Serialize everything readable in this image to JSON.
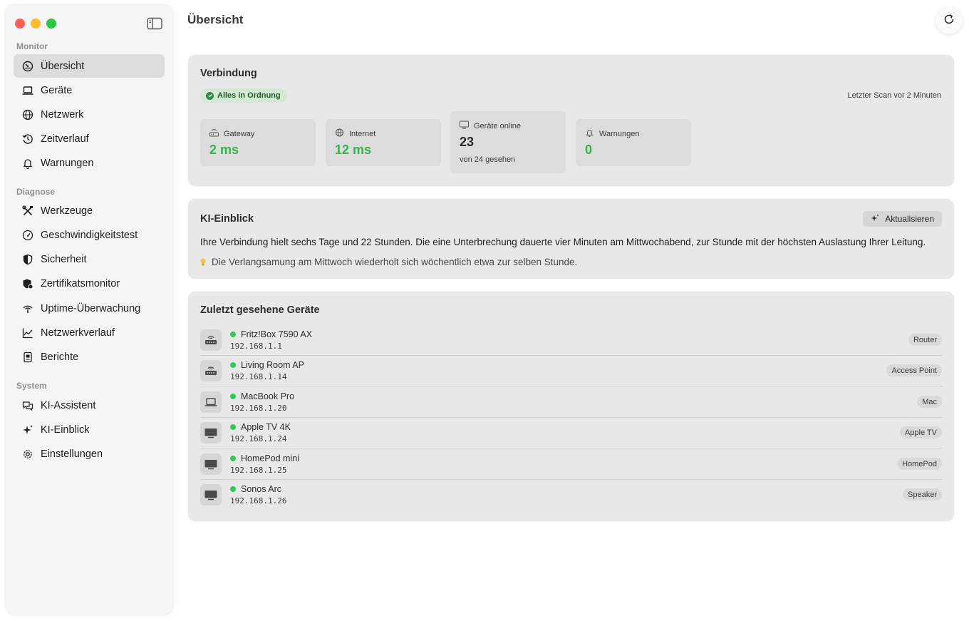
{
  "window": {
    "title": "Übersicht"
  },
  "sidebar": {
    "sections": [
      {
        "title": "Monitor",
        "items": [
          {
            "label": "Übersicht",
            "icon": "gauge-icon",
            "active": true
          },
          {
            "label": "Geräte",
            "icon": "laptop-icon"
          },
          {
            "label": "Netzwerk",
            "icon": "globe-icon"
          },
          {
            "label": "Zeitverlauf",
            "icon": "history-icon"
          },
          {
            "label": "Warnungen",
            "icon": "bell-icon"
          }
        ]
      },
      {
        "title": "Diagnose",
        "items": [
          {
            "label": "Werkzeuge",
            "icon": "tools-icon"
          },
          {
            "label": "Geschwindigkeitstest",
            "icon": "speedometer-icon"
          },
          {
            "label": "Sicherheit",
            "icon": "shield-icon"
          },
          {
            "label": "Zertifikatsmonitor",
            "icon": "certificate-shield-icon"
          },
          {
            "label": "Uptime-Überwachung",
            "icon": "antenna-icon"
          },
          {
            "label": "Netzwerkverlauf",
            "icon": "line-chart-icon"
          },
          {
            "label": "Berichte",
            "icon": "report-icon"
          }
        ]
      },
      {
        "title": "System",
        "items": [
          {
            "label": "KI-Assistent",
            "icon": "chat-bubbles-icon"
          },
          {
            "label": "KI-Einblick",
            "icon": "sparkles-icon"
          },
          {
            "label": "Einstellungen",
            "icon": "gear-icon"
          }
        ]
      }
    ]
  },
  "connection": {
    "title": "Verbindung",
    "status": "Alles in Ordnung",
    "last_scan": "Letzter Scan vor 2 Minuten",
    "metrics": [
      {
        "label": "Gateway",
        "value": "2 ms",
        "icon": "router-icon"
      },
      {
        "label": "Internet",
        "value": "12 ms",
        "icon": "globe-icon"
      },
      {
        "label": "Geräte online",
        "value": "23",
        "sub": "von 24 gesehen",
        "icon": "display-icon"
      },
      {
        "label": "Warnungen",
        "value": "0",
        "icon": "bell-icon"
      }
    ]
  },
  "insight": {
    "title": "KI-Einblick",
    "button": "Aktualisieren",
    "text": "Ihre Verbindung hielt sechs Tage und 22 Stunden. Die eine Unterbrechung dauerte vier Minuten am Mittwochabend, zur Stunde mit der höchsten Auslastung Ihrer Leitung.",
    "hint": "Die Verlangsamung am Mittwoch wiederholt sich wöchentlich etwa zur selben Stunde."
  },
  "devices": {
    "title": "Zuletzt gesehene Geräte",
    "items": [
      {
        "name": "Fritz!Box 7590 AX",
        "ip": "192.168.1.1",
        "tag": "Router",
        "icon": "router-icon"
      },
      {
        "name": "Living Room AP",
        "ip": "192.168.1.14",
        "tag": "Access Point",
        "icon": "router-icon"
      },
      {
        "name": "MacBook Pro",
        "ip": "192.168.1.20",
        "tag": "Mac",
        "icon": "laptop-icon"
      },
      {
        "name": "Apple TV 4K",
        "ip": "192.168.1.24",
        "tag": "Apple TV",
        "icon": "tv-icon"
      },
      {
        "name": "HomePod mini",
        "ip": "192.168.1.25",
        "tag": "HomePod",
        "icon": "tv-icon"
      },
      {
        "name": "Sonos Arc",
        "ip": "192.168.1.26",
        "tag": "Speaker",
        "icon": "tv-icon"
      }
    ]
  },
  "colors": {
    "good": "#34b34a",
    "status_dot": "#34c759",
    "accent_bg": "#d3e9d4"
  }
}
